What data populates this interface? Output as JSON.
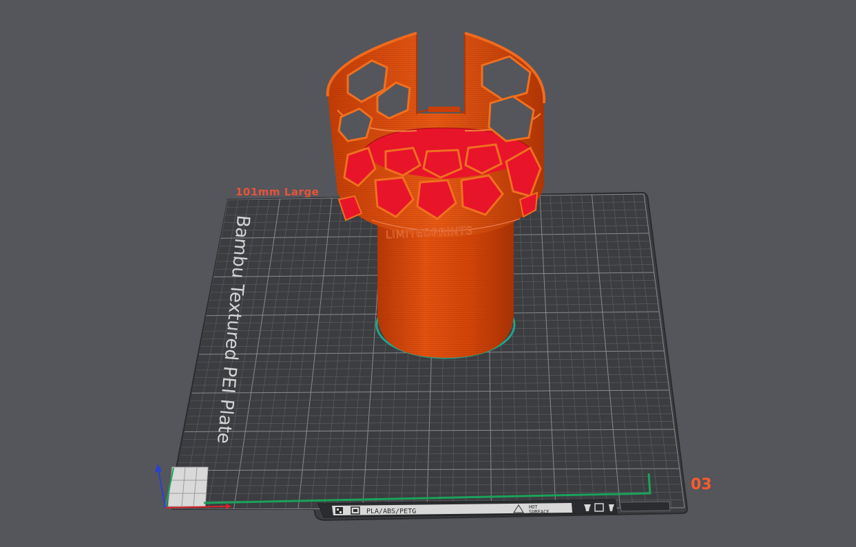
{
  "scene": {
    "plate_name_label": "101mm Large",
    "plate_index": "03",
    "bed_texture_label": "Bambu Textured PEI Plate",
    "front_strip": {
      "material_label": "PLA/ABS/PETG",
      "hot_surface_line1": "HOT",
      "hot_surface_line2": "SURFACE"
    },
    "model_emboss_text": "LIMITEDPRINTS"
  },
  "colors": {
    "background": "#54565b",
    "bed": "#3c3d40",
    "grid": "#6e7075",
    "model": "#d2440a",
    "model_inner": "#e8142a",
    "brim": "#1fa58a",
    "axis_x": "#d8232a",
    "axis_y": "#1aa35a",
    "axis_z": "#2a3fd6",
    "label_accent": "#ff5a2a"
  },
  "icons": [
    "bambu-logo-icon",
    "plate-icon",
    "hot-surface-warning-icon",
    "nozzle-icon",
    "plate-swap-icon",
    "axis-gizmo-icon"
  ]
}
